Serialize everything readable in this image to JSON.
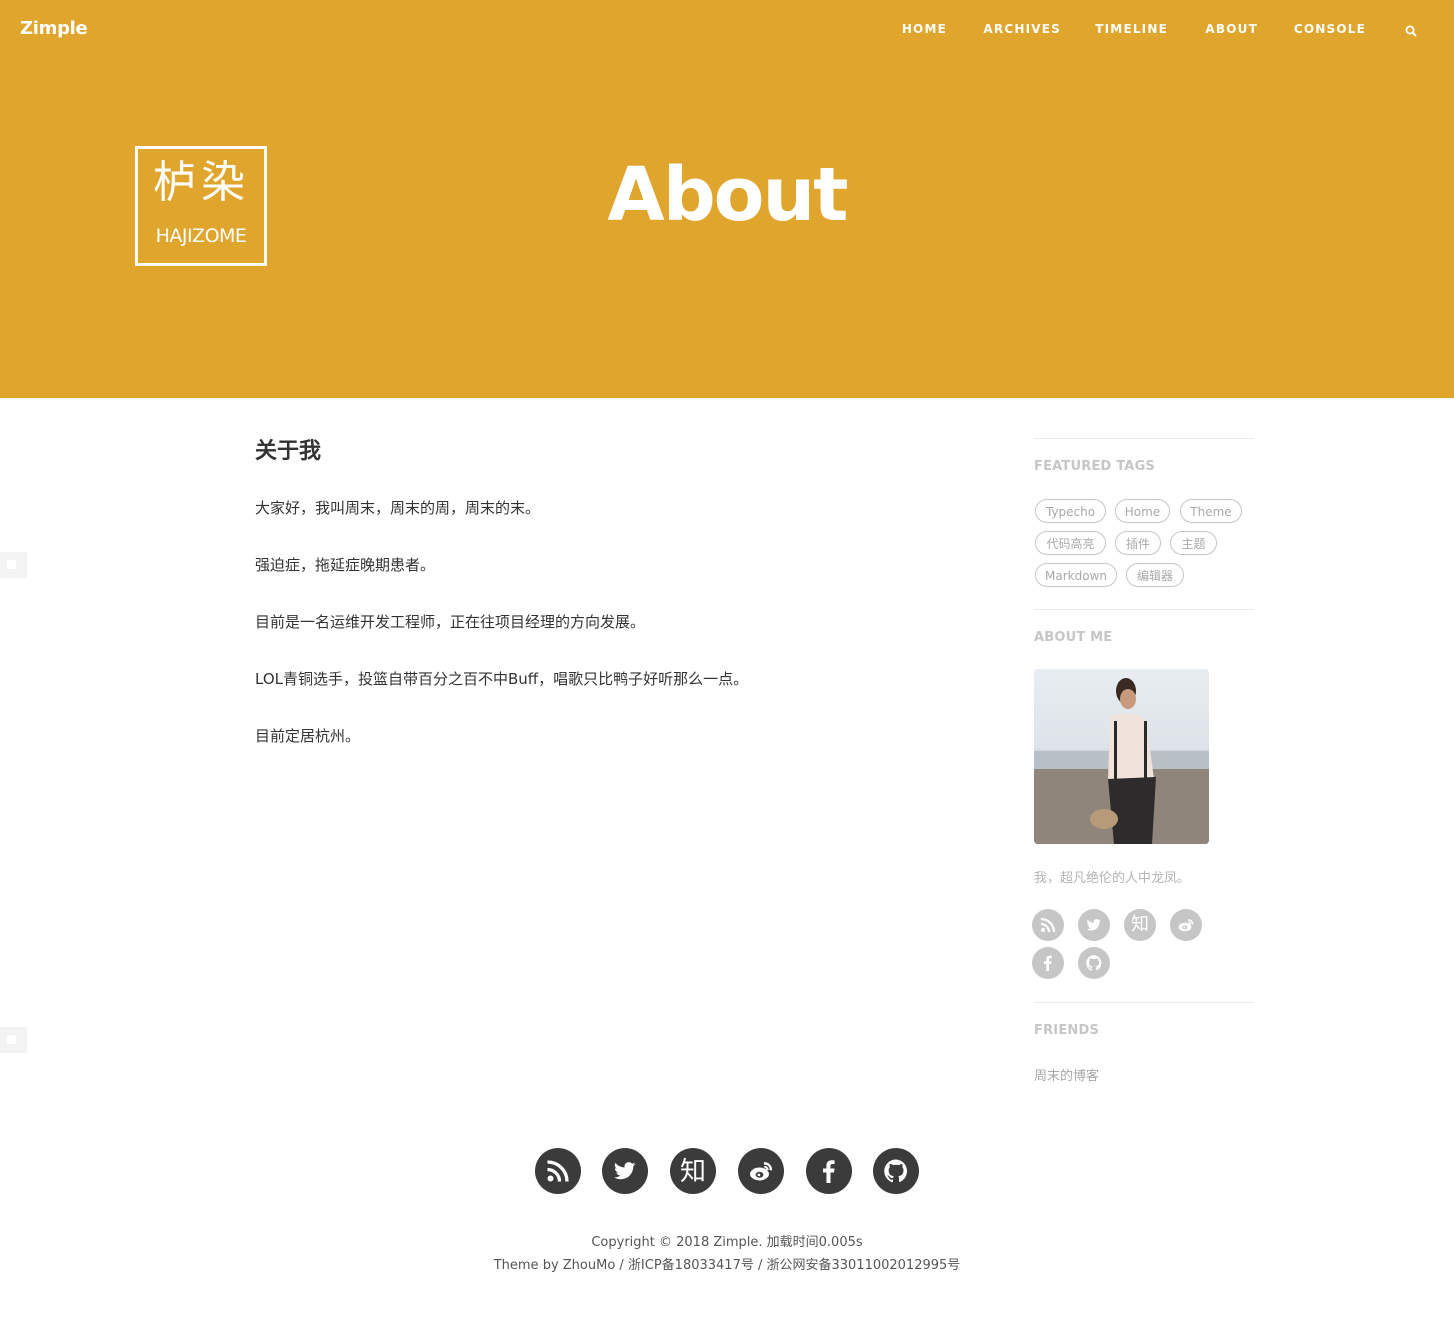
{
  "site": {
    "brand": "Zimple"
  },
  "nav": {
    "items": [
      {
        "label": "HOME"
      },
      {
        "label": "ARCHIVES"
      },
      {
        "label": "TIMELINE"
      },
      {
        "label": "ABOUT"
      },
      {
        "label": "CONSOLE"
      }
    ],
    "search_icon": "search-icon"
  },
  "hero": {
    "logo_cjk": "栌染",
    "logo_latin": "HAJIZOME",
    "title": "About",
    "background": "#dfa52d"
  },
  "content": {
    "heading": "关于我",
    "paragraphs": [
      "大家好，我叫周末，周末的周，周末的末。",
      "强迫症，拖延症晚期患者。",
      "目前是一名运维开发工程师，正在往项目经理的方向发展。",
      "LOL青铜选手，投篮自带百分之百不中Buff，唱歌只比鸭子好听那么一点。",
      "目前定居杭州。"
    ]
  },
  "sidebar": {
    "featured_tags": {
      "title": "FEATURED TAGS",
      "tags": [
        "Typecho",
        "Home",
        "Theme",
        "代码高亮",
        "插件",
        "主题",
        "Markdown",
        "编辑器"
      ]
    },
    "about_me": {
      "title": "ABOUT ME",
      "text": "我，超凡绝伦的人中龙凤。",
      "zhihu_glyph": "知",
      "social_icons": [
        "rss-icon",
        "twitter-icon",
        "zhihu-icon",
        "weibo-icon",
        "facebook-icon",
        "github-icon"
      ]
    },
    "friends": {
      "title": "FRIENDS",
      "links": [
        "周末的博客"
      ]
    }
  },
  "footer": {
    "zhihu_glyph": "知",
    "social_icons": [
      "rss-icon",
      "twitter-icon",
      "zhihu-icon",
      "weibo-icon",
      "facebook-icon",
      "github-icon"
    ],
    "copyright": "Copyright © 2018 Zimple. 加载时间0.005s",
    "credits": "Theme by ZhouMo / 浙ICP备18033417号 / 浙公网安备33011002012995号"
  },
  "colors": {
    "accent": "#dfa52d",
    "sidebar_icon": "#c6c6c6",
    "footer_icon": "#3b3b3b"
  }
}
